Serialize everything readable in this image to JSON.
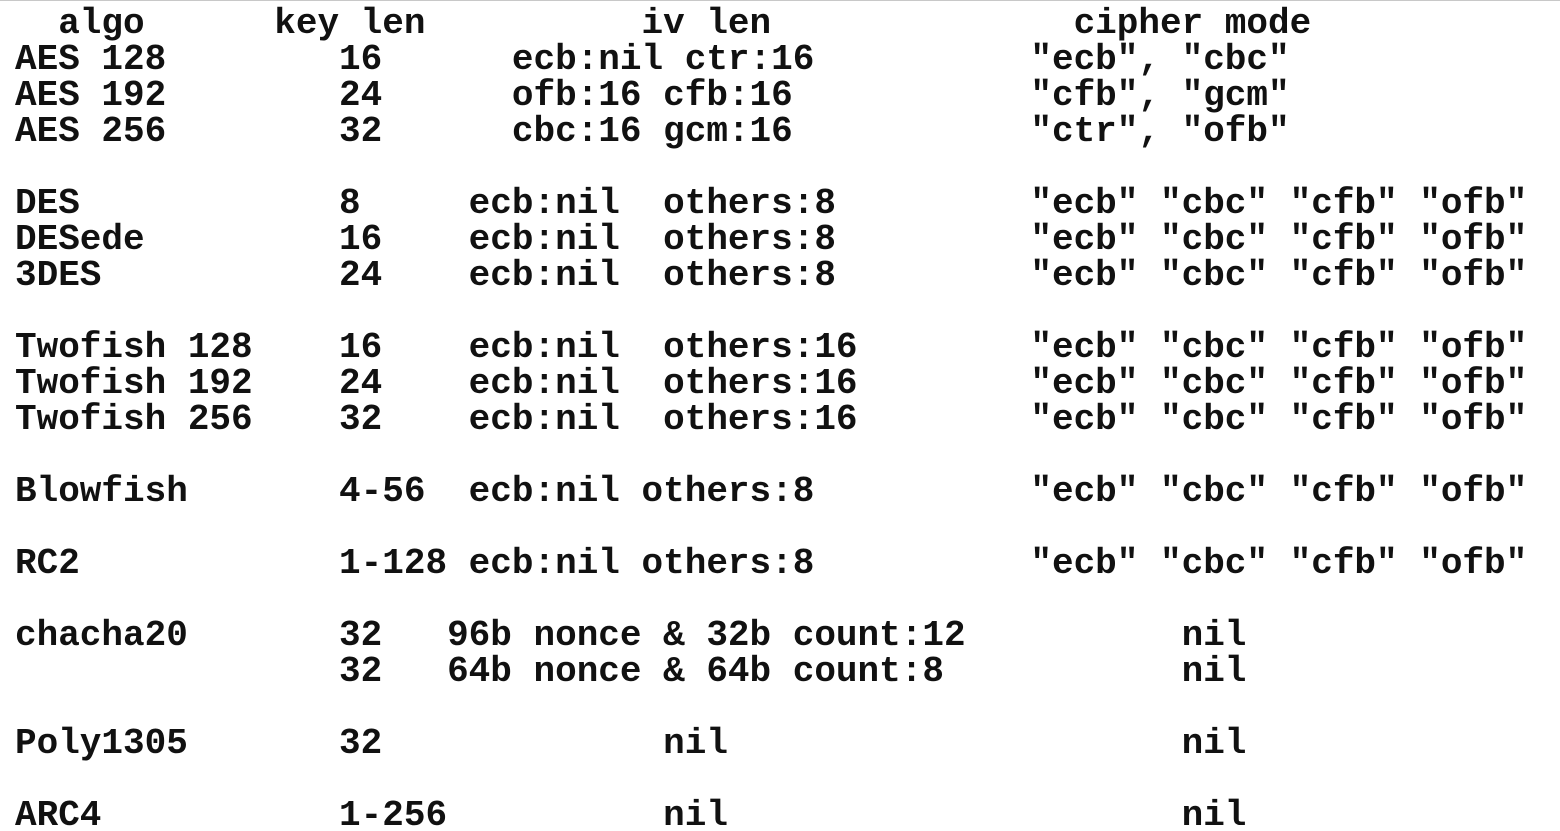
{
  "document": {
    "header": "  algo      key len          iv len              cipher mode",
    "lines": [
      "AES 128        16      ecb:nil ctr:16          \"ecb\", \"cbc\"",
      "AES 192        24      ofb:16 cfb:16           \"cfb\", \"gcm\"",
      "AES 256        32      cbc:16 gcm:16           \"ctr\", \"ofb\"",
      "DES            8     ecb:nil  others:8         \"ecb\" \"cbc\" \"cfb\" \"ofb\"",
      "DESede         16    ecb:nil  others:8         \"ecb\" \"cbc\" \"cfb\" \"ofb\"",
      "3DES           24    ecb:nil  others:8         \"ecb\" \"cbc\" \"cfb\" \"ofb\"",
      "Twofish 128    16    ecb:nil  others:16        \"ecb\" \"cbc\" \"cfb\" \"ofb\"",
      "Twofish 192    24    ecb:nil  others:16        \"ecb\" \"cbc\" \"cfb\" \"ofb\"",
      "Twofish 256    32    ecb:nil  others:16        \"ecb\" \"cbc\" \"cfb\" \"ofb\"",
      "Blowfish       4-56  ecb:nil others:8          \"ecb\" \"cbc\" \"cfb\" \"ofb\"",
      "RC2            1-128 ecb:nil others:8          \"ecb\" \"cbc\" \"cfb\" \"ofb\"",
      "chacha20       32   96b nonce & 32b count:12          nil",
      "               32   64b nonce & 64b count:8           nil",
      "Poly1305       32             nil                     nil",
      "ARC4           1-256          nil                     nil"
    ]
  }
}
